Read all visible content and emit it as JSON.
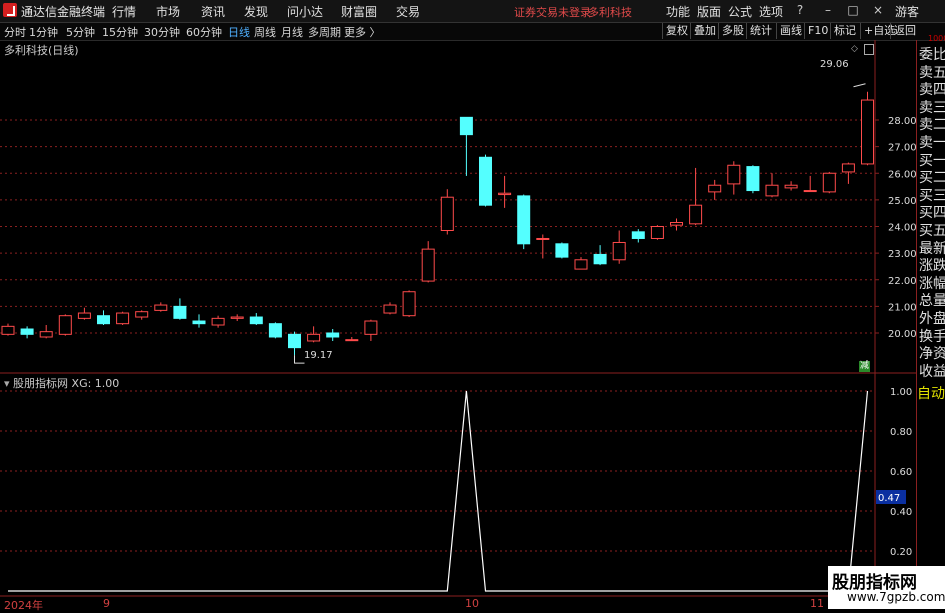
{
  "window": {
    "app_title": "通达信金融终端",
    "menus": [
      "行情",
      "市场",
      "资讯",
      "发现",
      "问小达",
      "财富圈",
      "交易"
    ],
    "warning": "证券交易未登录",
    "stock_name": "多利科技",
    "right_menus": [
      "功能",
      "版面",
      "公式",
      "选项"
    ],
    "guest": "游客"
  },
  "toolbar": {
    "periods": [
      "分时",
      "1分钟",
      "5分钟",
      "15分钟",
      "30分钟",
      "60分钟",
      "日线",
      "周线",
      "月线",
      "多周期",
      "更多 〉"
    ],
    "active_period": "日线",
    "right_buttons": [
      "复权",
      "叠加",
      "多股",
      "统计",
      "画线",
      "F10",
      "标记",
      "+自选",
      "返回"
    ]
  },
  "chart": {
    "title": "多利科技(日线)",
    "high_label": "29.06",
    "low_label": "19.17",
    "reduce_badge": "减",
    "y_ticks": [
      "28.00",
      "27.00",
      "26.00",
      "25.00",
      "24.00",
      "23.00",
      "22.00",
      "21.00",
      "20.00"
    ]
  },
  "chart_data": [
    {
      "type": "candlestick",
      "title": "多利科技(日线)",
      "ylim": [
        19.0,
        29.2
      ],
      "series": [
        {
          "o": 19.95,
          "c": 20.25,
          "h": 20.35,
          "l": 19.9
        },
        {
          "o": 20.15,
          "c": 19.95,
          "h": 20.25,
          "l": 19.8
        },
        {
          "o": 19.85,
          "c": 20.05,
          "h": 20.3,
          "l": 19.8
        },
        {
          "o": 19.95,
          "c": 20.65,
          "h": 20.7,
          "l": 19.9
        },
        {
          "o": 20.55,
          "c": 20.75,
          "h": 20.95,
          "l": 20.5
        },
        {
          "o": 20.65,
          "c": 20.35,
          "h": 20.85,
          "l": 20.3
        },
        {
          "o": 20.35,
          "c": 20.75,
          "h": 20.8,
          "l": 20.3
        },
        {
          "o": 20.6,
          "c": 20.8,
          "h": 20.85,
          "l": 20.5
        },
        {
          "o": 20.85,
          "c": 21.05,
          "h": 21.15,
          "l": 20.8
        },
        {
          "o": 21.0,
          "c": 20.55,
          "h": 21.3,
          "l": 20.5
        },
        {
          "o": 20.45,
          "c": 20.35,
          "h": 20.7,
          "l": 20.2
        },
        {
          "o": 20.3,
          "c": 20.55,
          "h": 20.65,
          "l": 20.2
        },
        {
          "o": 20.55,
          "c": 20.6,
          "h": 20.7,
          "l": 20.45
        },
        {
          "o": 20.6,
          "c": 20.35,
          "h": 20.75,
          "l": 20.3
        },
        {
          "o": 20.35,
          "c": 19.85,
          "h": 20.4,
          "l": 19.8
        },
        {
          "o": 19.95,
          "c": 19.45,
          "h": 20.05,
          "l": 19.17
        },
        {
          "o": 19.7,
          "c": 19.95,
          "h": 20.25,
          "l": 19.65
        },
        {
          "o": 20.0,
          "c": 19.85,
          "h": 20.15,
          "l": 19.7
        },
        {
          "o": 19.75,
          "c": 19.75,
          "h": 19.85,
          "l": 19.7
        },
        {
          "o": 19.95,
          "c": 20.45,
          "h": 20.5,
          "l": 19.7
        },
        {
          "o": 20.75,
          "c": 21.05,
          "h": 21.15,
          "l": 20.7
        },
        {
          "o": 20.65,
          "c": 21.55,
          "h": 21.6,
          "l": 20.6
        },
        {
          "o": 21.95,
          "c": 23.15,
          "h": 23.45,
          "l": 21.9
        },
        {
          "o": 23.85,
          "c": 25.1,
          "h": 25.4,
          "l": 23.7
        },
        {
          "o": 28.1,
          "c": 27.45,
          "h": 28.1,
          "l": 25.9
        },
        {
          "o": 26.6,
          "c": 24.8,
          "h": 26.7,
          "l": 24.75
        },
        {
          "o": 25.2,
          "c": 25.25,
          "h": 25.9,
          "l": 24.7
        },
        {
          "o": 25.15,
          "c": 23.35,
          "h": 25.2,
          "l": 23.15
        },
        {
          "o": 23.55,
          "c": 23.55,
          "h": 23.7,
          "l": 22.8
        },
        {
          "o": 23.35,
          "c": 22.85,
          "h": 23.4,
          "l": 22.8
        },
        {
          "o": 22.4,
          "c": 22.75,
          "h": 22.85,
          "l": 22.4
        },
        {
          "o": 22.95,
          "c": 22.6,
          "h": 23.3,
          "l": 22.55
        },
        {
          "o": 22.75,
          "c": 23.4,
          "h": 23.85,
          "l": 22.6
        },
        {
          "o": 23.8,
          "c": 23.55,
          "h": 23.9,
          "l": 23.4
        },
        {
          "o": 23.55,
          "c": 24.0,
          "h": 24.05,
          "l": 23.5
        },
        {
          "o": 24.05,
          "c": 24.15,
          "h": 24.3,
          "l": 23.85
        },
        {
          "o": 24.1,
          "c": 24.8,
          "h": 26.2,
          "l": 24.05
        },
        {
          "o": 25.3,
          "c": 25.55,
          "h": 25.75,
          "l": 25.0
        },
        {
          "o": 25.6,
          "c": 26.3,
          "h": 26.45,
          "l": 25.2
        },
        {
          "o": 26.25,
          "c": 25.35,
          "h": 26.3,
          "l": 25.25
        },
        {
          "o": 25.15,
          "c": 25.55,
          "h": 26.0,
          "l": 25.1
        },
        {
          "o": 25.45,
          "c": 25.55,
          "h": 25.7,
          "l": 25.35
        },
        {
          "o": 25.35,
          "c": 25.35,
          "h": 25.9,
          "l": 25.3
        },
        {
          "o": 25.3,
          "c": 26.0,
          "h": 26.05,
          "l": 25.25
        },
        {
          "o": 26.05,
          "c": 26.35,
          "h": 26.4,
          "l": 25.6
        },
        {
          "o": 26.35,
          "c": 28.75,
          "h": 29.06,
          "l": 26.3
        }
      ]
    },
    {
      "type": "line",
      "title": "股朋指标网",
      "series": [
        {
          "name": "XG",
          "values": [
            0,
            0,
            0,
            0,
            0,
            0,
            0,
            0,
            0,
            0,
            0,
            0,
            0,
            0,
            0,
            0,
            0,
            0,
            0,
            0,
            0,
            0,
            0,
            0,
            1,
            0,
            0,
            0,
            0,
            0,
            0,
            0,
            0,
            0,
            0,
            0,
            0,
            0,
            0,
            0,
            0,
            0,
            0,
            0,
            0,
            1
          ]
        }
      ],
      "ylim": [
        0,
        1.05
      ],
      "y_ticks": [
        "1.00",
        "0.80",
        "0.60",
        "0.40",
        "0.20"
      ]
    }
  ],
  "indicator": {
    "title": "股朋指标网",
    "value_label": "XG: 1.00",
    "current_value": "0.47"
  },
  "right_panel": [
    "委比",
    "卖五",
    "卖四",
    "卖三",
    "卖二",
    "卖一",
    "买一",
    "买二",
    "买三",
    "买四",
    "买五",
    "最新",
    "涨跌",
    "涨幅",
    "总量",
    "外盘",
    "换手",
    "净资",
    "收益"
  ],
  "right_panel_top": "1000",
  "auto_button": "自动",
  "x_axis": {
    "labels": [
      "2024年",
      "9",
      "10",
      "11"
    ]
  },
  "watermark": {
    "line1": "股朋指标网",
    "line2": "www.7gpzb.com"
  },
  "colors": {
    "up": "#ff4b4b",
    "down": "#54ffff",
    "grid": "#8b2020",
    "bg": "#000000"
  }
}
